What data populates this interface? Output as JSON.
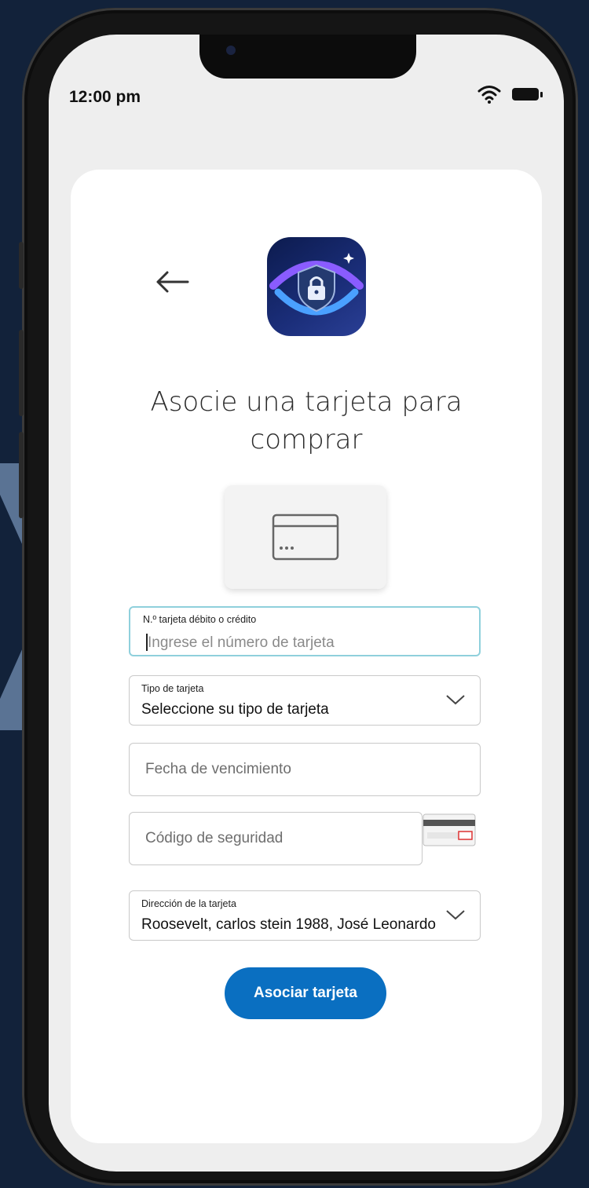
{
  "status_bar": {
    "time": "12:00 pm"
  },
  "header": {
    "title": "Asocie una tarjeta para comprar"
  },
  "form": {
    "card_number": {
      "label": "N.º tarjeta débito o crédito",
      "placeholder": "Ingrese el número de tarjeta"
    },
    "card_type": {
      "label": "Tipo de tarjeta",
      "value": "Seleccione su tipo de tarjeta"
    },
    "expiry": {
      "placeholder": "Fecha de vencimiento"
    },
    "security_code": {
      "placeholder": "Código de seguridad"
    },
    "card_address": {
      "label": "Dirección de la tarjeta",
      "value": "Roosevelt, carlos stein 1988, José Leonardo"
    }
  },
  "actions": {
    "submit_label": "Asociar tarjeta"
  },
  "colors": {
    "background": "#12223a",
    "accent": "#0a6fc1",
    "focus_border": "#8fd0dc",
    "chevron": "#5a7394"
  },
  "icons": [
    "wifi-icon",
    "battery-icon",
    "back-arrow-icon",
    "app-shield-lock-logo",
    "credit-card-icon",
    "chevron-down-icon",
    "card-back-cvv-icon"
  ]
}
